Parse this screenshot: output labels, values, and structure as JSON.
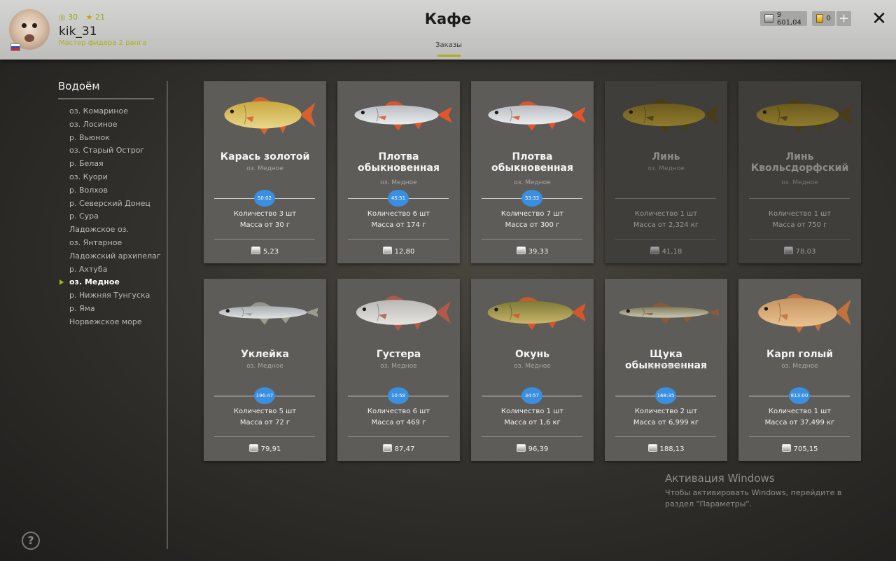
{
  "header": {
    "title": "Кафе",
    "tab": "Заказы",
    "player": {
      "username": "kik_31",
      "rank": "Мастер фидера 2 ранга",
      "level": "30",
      "stars": "21"
    },
    "silver": "9 601,04",
    "gold": "0",
    "plus": "+",
    "close": "✕"
  },
  "sidebar": {
    "title": "Водоём",
    "items": [
      "оз. Комариное",
      "оз. Лосиное",
      "р. Вьюнок",
      "оз. Старый Острог",
      "р. Белая",
      "оз. Куори",
      "р. Волхов",
      "р. Северский Донец",
      "р. Сура",
      "Ладожское оз.",
      "оз. Янтарное",
      "Ладожский архипелаг",
      "р. Ахтуба",
      "оз. Медное",
      "р. Нижняя Тунгуска",
      "р. Яма",
      "Норвежское море"
    ],
    "active_index": 13,
    "help": "?"
  },
  "orders": [
    {
      "name": "Карась золотой",
      "location": "оз. Медное",
      "timer": "50:02",
      "quantity": "Количество 3 шт",
      "mass": "Масса от 30 г",
      "price": "5,23",
      "available": true,
      "icon": "crucian-carp-icon"
    },
    {
      "name": "Плотва обыкновенная",
      "location": "оз. Медное",
      "timer": "45:51",
      "quantity": "Количество 6 шт",
      "mass": "Масса от 174 г",
      "price": "12,80",
      "available": true,
      "icon": "roach-icon"
    },
    {
      "name": "Плотва обыкновенная",
      "location": "оз. Медное",
      "timer": "33:33",
      "quantity": "Количество 7 шт",
      "mass": "Масса от 300 г",
      "price": "39,33",
      "available": true,
      "icon": "roach-icon"
    },
    {
      "name": "Линь",
      "location": "оз. Медное",
      "timer": "",
      "quantity": "Количество 1 шт",
      "mass": "Масса от 2,324 кг",
      "price": "41,18",
      "available": false,
      "icon": "tench-icon"
    },
    {
      "name": "Линь Квольсдорфский",
      "location": "оз. Медное",
      "timer": "",
      "quantity": "Количество 1 шт",
      "mass": "Масса от 750 г",
      "price": "78,03",
      "available": false,
      "icon": "tench-icon"
    },
    {
      "name": "Уклейка",
      "location": "оз. Медное",
      "timer": "196:47",
      "quantity": "Количество 5 шт",
      "mass": "Масса от 72 г",
      "price": "79,91",
      "available": true,
      "icon": "bleak-icon"
    },
    {
      "name": "Густера",
      "location": "оз. Медное",
      "timer": "10:58",
      "quantity": "Количество 6 шт",
      "mass": "Масса от 469 г",
      "price": "87,47",
      "available": true,
      "icon": "silver-bream-icon"
    },
    {
      "name": "Окунь",
      "location": "оз. Медное",
      "timer": "34:57",
      "quantity": "Количество 1 шт",
      "mass": "Масса от 1,6 кг",
      "price": "96,39",
      "available": true,
      "icon": "perch-icon"
    },
    {
      "name": "Щука обыкновенная",
      "location": "оз. Медное",
      "timer": "168:35",
      "quantity": "Количество 2 шт",
      "mass": "Масса от 6,999 кг",
      "price": "188,13",
      "available": true,
      "icon": "pike-icon"
    },
    {
      "name": "Карп голый",
      "location": "оз. Медное",
      "timer": "813:00",
      "quantity": "Количество 1 шт",
      "mass": "Масса от 37,499 кг",
      "price": "705,15",
      "available": true,
      "icon": "leather-carp-icon"
    }
  ],
  "watermark": {
    "title": "Активация Windows",
    "text": "Чтобы активировать Windows, перейдите в раздел \"Параметры\"."
  },
  "colors": {
    "accent": "#a7b21a",
    "timer": "#3a8fe0",
    "card": "#5d5c59",
    "card_disabled": "#3f3e3b"
  }
}
